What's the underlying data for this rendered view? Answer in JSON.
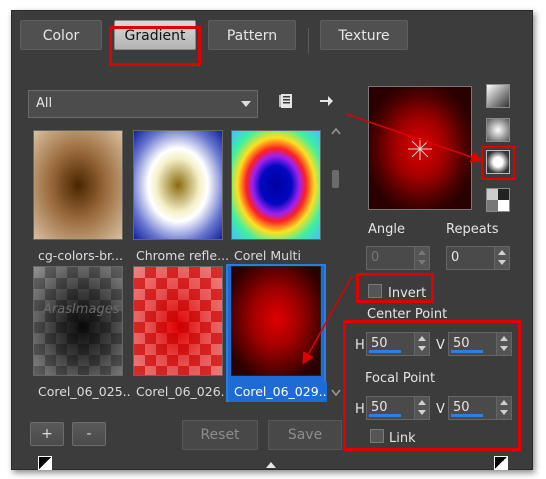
{
  "tabs": [
    {
      "label": "Color"
    },
    {
      "label": "Gradient"
    },
    {
      "label": "Pattern"
    },
    {
      "label": "Texture"
    }
  ],
  "library": {
    "dropdown_value": "All",
    "items": [
      {
        "label": "cg-colors-br..."
      },
      {
        "label": "Chrome refle..."
      },
      {
        "label": "Corel Multi"
      },
      {
        "label": "Corel_06_025..."
      },
      {
        "label": "Corel_06_026..."
      },
      {
        "label": "Corel_06_029..."
      }
    ],
    "watermark": "ArasImages"
  },
  "buttons": {
    "add": "+",
    "remove": "-",
    "reset": "Reset",
    "save": "Save"
  },
  "settings": {
    "angle_label": "Angle",
    "angle_value": "0",
    "repeats_label": "Repeats",
    "repeats_value": "0",
    "invert_label": "Invert",
    "invert_checked": false,
    "center_point_label": "Center Point",
    "center_h_label": "H",
    "center_h_value": "50",
    "center_v_label": "V",
    "center_v_value": "50",
    "focal_point_label": "Focal Point",
    "focal_h_label": "H",
    "focal_h_value": "50",
    "focal_v_label": "V",
    "focal_v_value": "50",
    "link_label": "Link",
    "link_checked": false
  },
  "colors": {
    "highlight": "#e00000",
    "selection": "#1e6bd6",
    "panel": "#3c3c3c"
  }
}
